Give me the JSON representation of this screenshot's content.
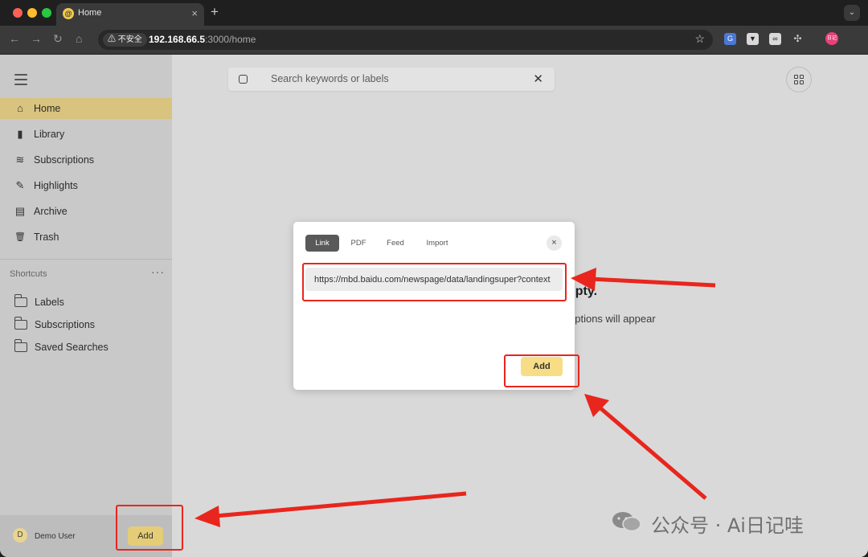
{
  "browser": {
    "tab_title": "Home",
    "tab_favicon": "@",
    "security_label": "不安全",
    "url_host": "192.168.66.5",
    "url_rest": ":3000/home",
    "extension_badge": "日记"
  },
  "sidebar": {
    "items": [
      {
        "label": "Home",
        "icon": "home-icon",
        "glyph": "⌂"
      },
      {
        "label": "Library",
        "icon": "bookmark-icon",
        "glyph": "▮"
      },
      {
        "label": "Subscriptions",
        "icon": "layers-icon",
        "glyph": "≋"
      },
      {
        "label": "Highlights",
        "icon": "highlighter-icon",
        "glyph": "✎"
      },
      {
        "label": "Archive",
        "icon": "archive-icon",
        "glyph": "▤"
      },
      {
        "label": "Trash",
        "icon": "trash-icon",
        "glyph": "🗑"
      }
    ],
    "shortcuts_title": "Shortcuts",
    "shortcuts_more": "···",
    "shortcuts": [
      "Labels",
      "Subscriptions",
      "Saved Searches"
    ],
    "user_initial": "D",
    "user_name": "Demo User",
    "add_label": "Add"
  },
  "main": {
    "search_placeholder": "Search keywords or labels",
    "empty_title": "npty.",
    "empty_subtitle": "options will appear"
  },
  "modal": {
    "tabs": [
      "Link",
      "PDF",
      "Feed",
      "Import"
    ],
    "active_tab": "Link",
    "url_value": "https://mbd.baidu.com/newspage/data/landingsuper?context",
    "add_label": "Add",
    "close_glyph": "×"
  },
  "watermark": "公众号 · Ai日记哇",
  "colors": {
    "accent": "#d8c37f",
    "add_button": "#f7dd85",
    "annotation": "#e8261d"
  }
}
